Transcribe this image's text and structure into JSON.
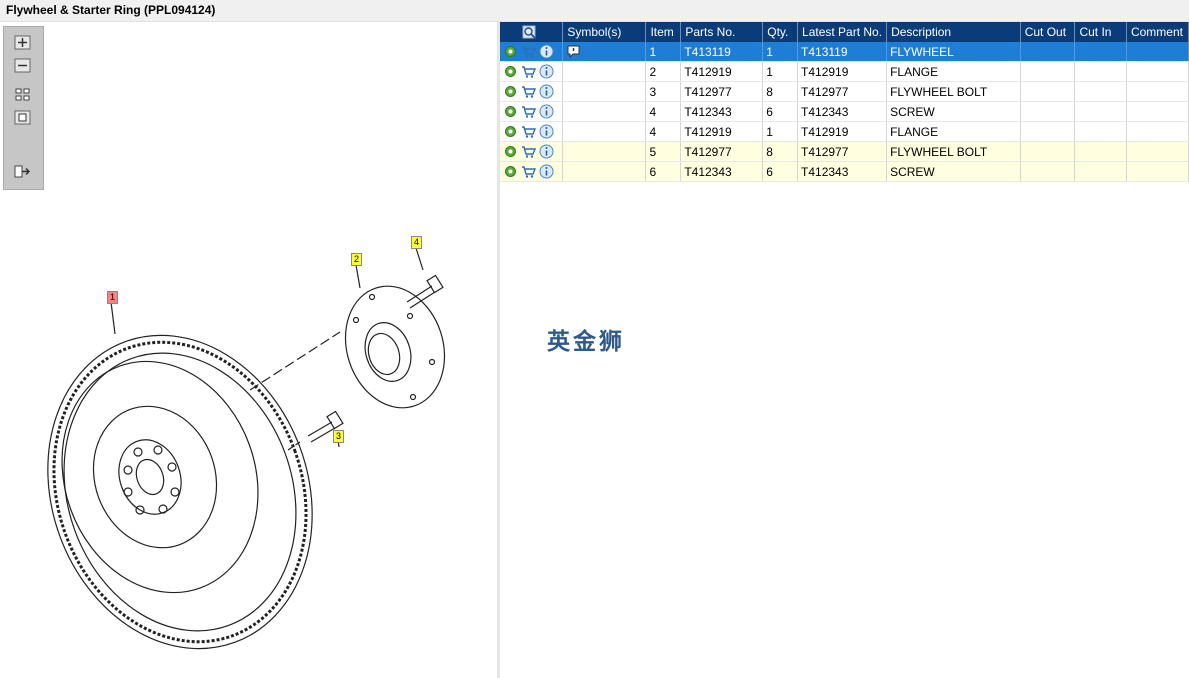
{
  "window": {
    "title": "Flywheel & Starter Ring (PPL094124)"
  },
  "toolbar": {
    "icons": [
      "zoom-in-icon",
      "zoom-out-icon",
      "fit-all-icon",
      "fit-window-icon",
      "export-icon"
    ]
  },
  "diagram": {
    "callouts": [
      "1",
      "2",
      "3",
      "4"
    ]
  },
  "table": {
    "columns": [
      "",
      "Symbol(s)",
      "Item",
      "Parts No.",
      "Qty.",
      "Latest Part No.",
      "Description",
      "Cut Out",
      "Cut In",
      "Comment"
    ],
    "rows": [
      {
        "item": "1",
        "part_no": "T413119",
        "qty": "1",
        "latest": "T413119",
        "description": "FLYWHEEL",
        "cut_out": "",
        "cut_in": "",
        "comment": ""
      },
      {
        "item": "2",
        "part_no": "T412919",
        "qty": "1",
        "latest": "T412919",
        "description": "FLANGE",
        "cut_out": "",
        "cut_in": "",
        "comment": ""
      },
      {
        "item": "3",
        "part_no": "T412977",
        "qty": "8",
        "latest": "T412977",
        "description": "FLYWHEEL BOLT",
        "cut_out": "",
        "cut_in": "",
        "comment": ""
      },
      {
        "item": "4",
        "part_no": "T412343",
        "qty": "6",
        "latest": "T412343",
        "description": "SCREW",
        "cut_out": "",
        "cut_in": "",
        "comment": ""
      },
      {
        "item": "4",
        "part_no": "T412919",
        "qty": "1",
        "latest": "T412919",
        "description": "FLANGE",
        "cut_out": "",
        "cut_in": "",
        "comment": ""
      },
      {
        "item": "5",
        "part_no": "T412977",
        "qty": "8",
        "latest": "T412977",
        "description": "FLYWHEEL BOLT",
        "cut_out": "",
        "cut_in": "",
        "comment": ""
      },
      {
        "item": "6",
        "part_no": "T412343",
        "qty": "6",
        "latest": "T412343",
        "description": "SCREW",
        "cut_out": "",
        "cut_in": "",
        "comment": ""
      }
    ]
  },
  "watermark": "英金狮",
  "colors": {
    "header": "#0a3c7a",
    "selected": "#1e7ed6",
    "highlight": "#ffffe0"
  }
}
